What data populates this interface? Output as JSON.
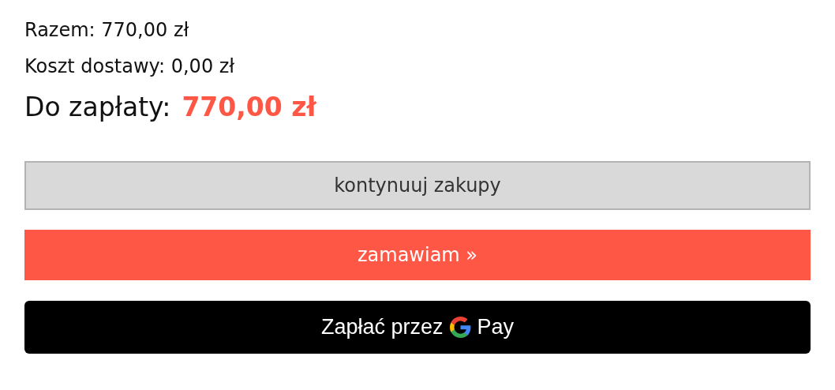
{
  "summary_lines": [
    {
      "text": "Razem: 770,00 zł"
    },
    {
      "text": "Koszt dostawy: 0,00 zł"
    }
  ],
  "total": {
    "label": "Do zapłaty:",
    "amount": "770,00 zł"
  },
  "buttons": [
    {
      "kind": "secondary",
      "label": "kontynuuj zakupy"
    },
    {
      "kind": "primary",
      "label": "zamawiam »"
    },
    {
      "kind": "gpay",
      "label": "Zapłać przez",
      "brand": "Pay"
    }
  ]
}
